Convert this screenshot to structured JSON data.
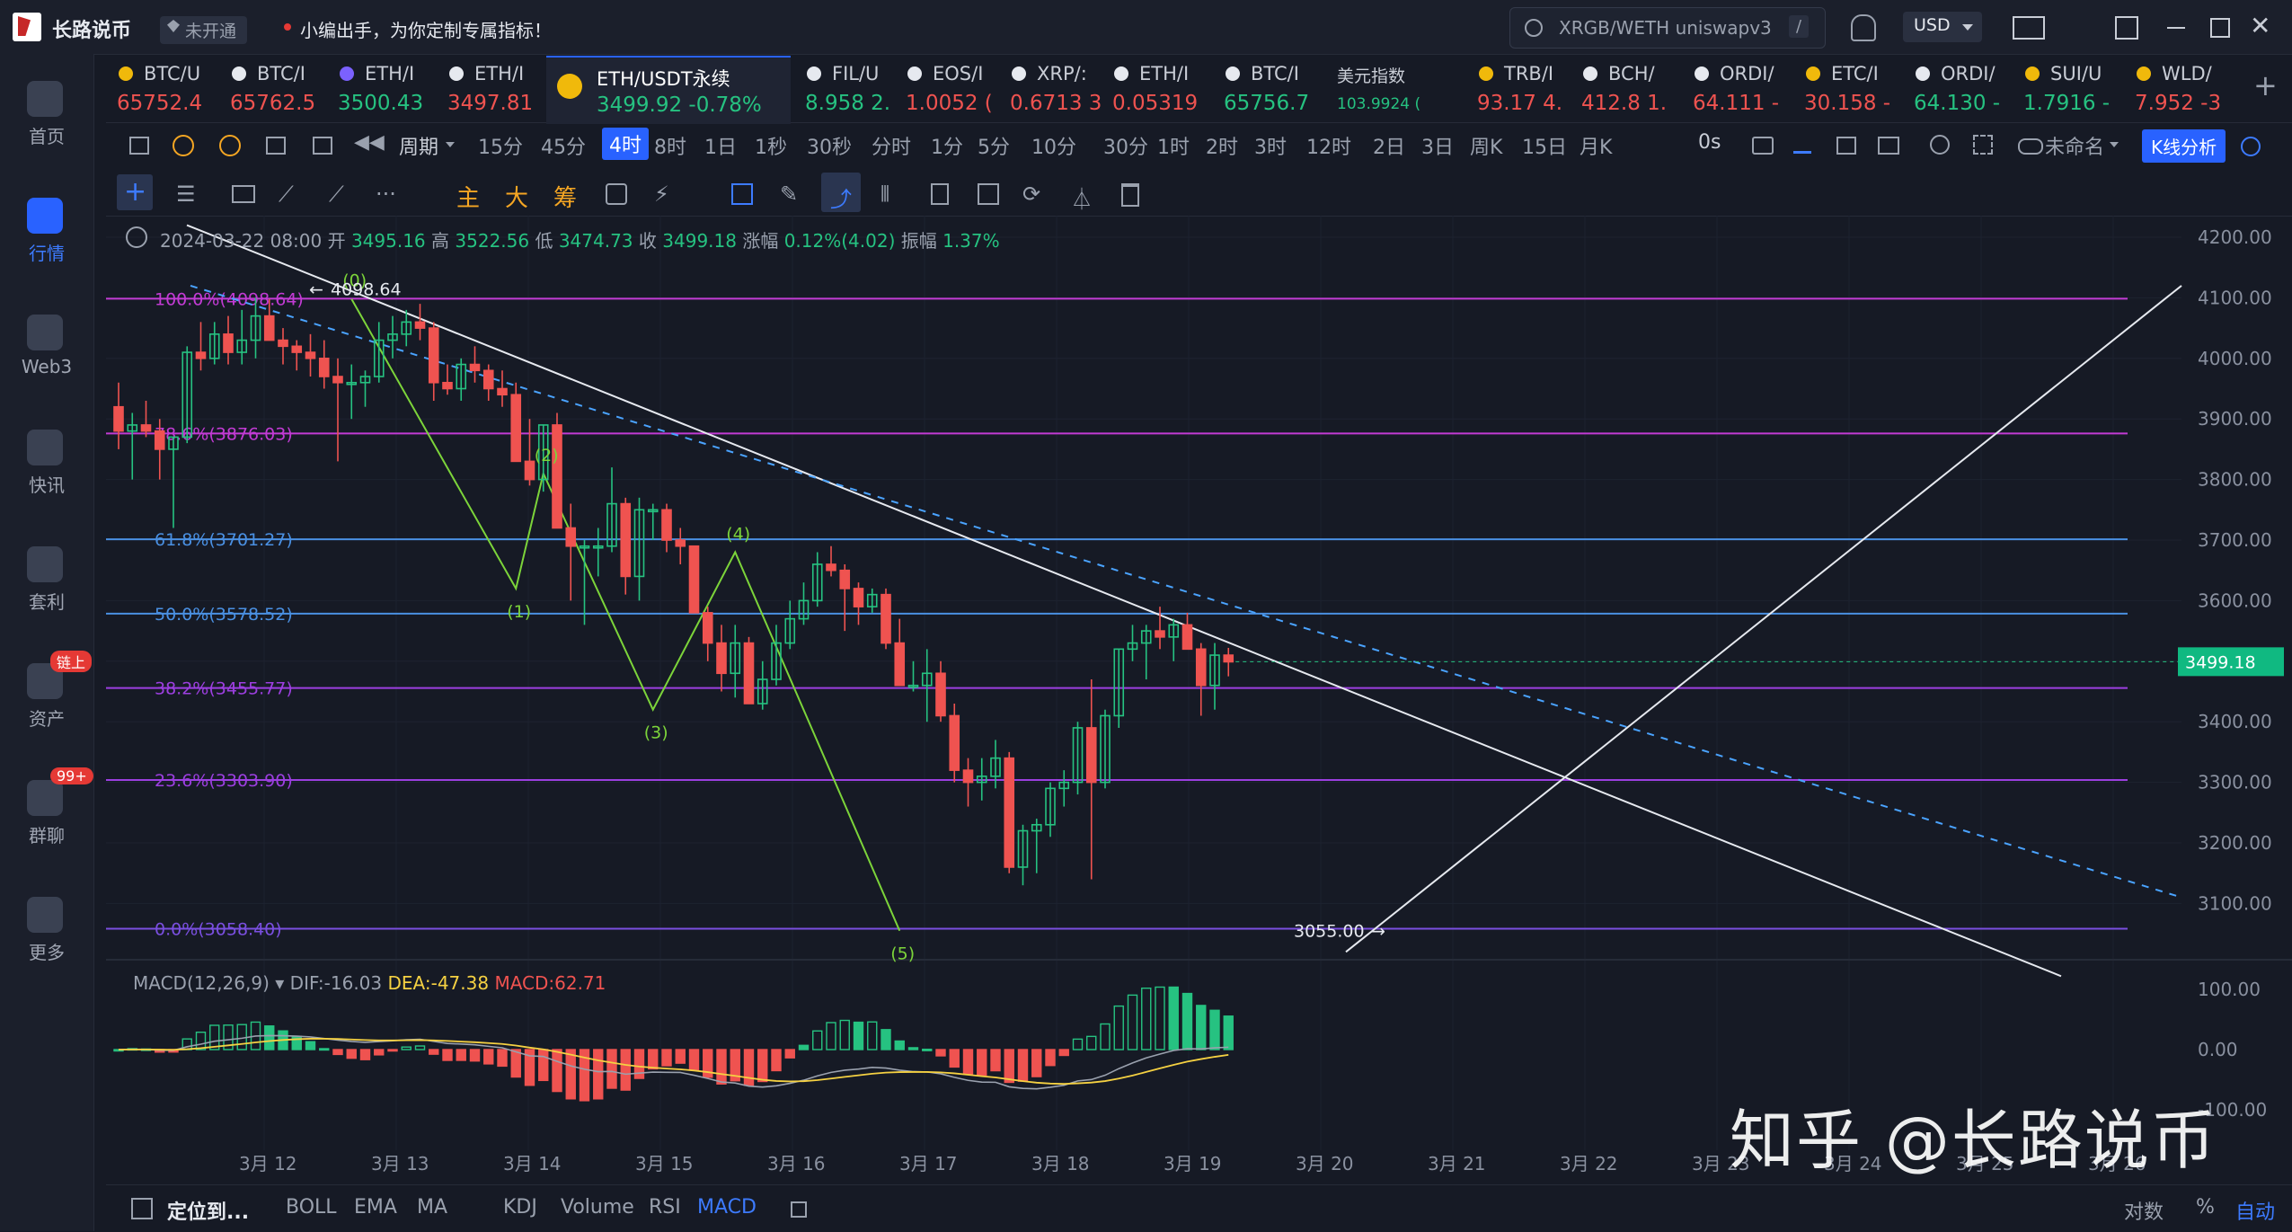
{
  "topbar": {
    "app_name": "长路说币",
    "status": "未开通",
    "notice": "小编出手，为你定制专属指标！",
    "search_placeholder": "XRGB/WETH uniswapv3",
    "search_hint": "/",
    "currency": "USD"
  },
  "tickers": [
    {
      "name": "BTC/U",
      "price": "65752.4",
      "dir": "down",
      "icon": "binance-icon"
    },
    {
      "name": "BTC/I",
      "price": "65762.5",
      "dir": "down",
      "icon": "okx-icon"
    },
    {
      "name": "ETH/I",
      "price": "3500.43",
      "dir": "up",
      "icon": "coin-icon"
    },
    {
      "name": "ETH/I",
      "price": "3497.81",
      "dir": "down",
      "icon": "okx-icon"
    },
    {
      "name": "ETH/USDT永续",
      "price": "3499.92  -0.78%",
      "dir": "up",
      "icon": "binance-icon",
      "active": true
    },
    {
      "name": "FIL/U",
      "price": "8.958  2.",
      "dir": "up",
      "icon": "okx-icon"
    },
    {
      "name": "EOS/I",
      "price": "1.0052  (",
      "dir": "down",
      "icon": "okx-icon"
    },
    {
      "name": "XRP/:",
      "price": "0.6713  3",
      "dir": "down",
      "icon": "okx-icon"
    },
    {
      "name": "ETH/I",
      "price": "0.05319",
      "dir": "down",
      "icon": "okx-icon"
    },
    {
      "name": "BTC/I",
      "price": "65756.7",
      "dir": "up",
      "icon": "okx-icon"
    },
    {
      "name": "美元指数",
      "price": "103.9924  (",
      "dir": "up",
      "icon": ""
    },
    {
      "name": "TRB/I",
      "price": "93.17  4.",
      "dir": "down",
      "icon": "binance-icon"
    },
    {
      "name": "BCH/",
      "price": "412.8  1.",
      "dir": "down",
      "icon": "okx-icon"
    },
    {
      "name": "ORDI/",
      "price": "64.111  -",
      "dir": "down",
      "icon": "okx-icon"
    },
    {
      "name": "ETC/I",
      "price": "30.158  -",
      "dir": "down",
      "icon": "binance-icon"
    },
    {
      "name": "ORDI/",
      "price": "64.130  -",
      "dir": "up",
      "icon": "okx-icon"
    },
    {
      "name": "SUI/U",
      "price": "1.7916  -",
      "dir": "up",
      "icon": "binance-icon"
    },
    {
      "name": "WLD/",
      "price": "7.952  -3",
      "dir": "down",
      "icon": "binance-icon"
    }
  ],
  "sidebar": [
    {
      "label": "首页",
      "icon": "home-icon"
    },
    {
      "label": "行情",
      "icon": "market-icon",
      "active": true
    },
    {
      "label": "Web3",
      "icon": "web3-icon"
    },
    {
      "label": "快讯",
      "icon": "news-icon"
    },
    {
      "label": "套利",
      "icon": "arbitrage-icon"
    },
    {
      "label": "资产",
      "icon": "wallet-icon",
      "badge": "链上"
    },
    {
      "label": "群聊",
      "icon": "chat-icon",
      "badge": "99+"
    },
    {
      "label": "更多",
      "icon": "more-icon"
    }
  ],
  "periods": {
    "label": "周期",
    "items": [
      "15分",
      "45分",
      "4时",
      "8时",
      "1日",
      "1秒",
      "30秒",
      "分时",
      "1分",
      "5分",
      "10分",
      "30分",
      "1时",
      "2时",
      "3时",
      "12时",
      "2日",
      "3日",
      "周K",
      "15日",
      "月K"
    ],
    "active": "4时",
    "countdown": "0s",
    "layout_name": "未命名",
    "kline_button": "K线分析"
  },
  "toolbar": {
    "indicator_buttons": [
      "主",
      "大",
      "筹"
    ]
  },
  "candle_info": {
    "time": "2024-03-22 08:00",
    "open_label": "开",
    "open": "3495.16",
    "high_label": "高",
    "high": "3522.56",
    "low_label": "低",
    "low": "3474.73",
    "close_label": "收",
    "close": "3499.18",
    "change_label": "涨幅",
    "change": "0.12%(4.02)",
    "amp_label": "振幅",
    "amp": "1.37%"
  },
  "macd_info": {
    "name": "MACD(12,26,9)",
    "dif": "DIF:-16.03",
    "dea": "DEA:-47.38",
    "macd": "MACD:62.71"
  },
  "chart_data": {
    "type": "candlestick",
    "symbol": "ETH/USDT永续",
    "interval": "4时",
    "ylim": [
      3000,
      4200
    ],
    "y_ticks": [
      "4200.00",
      "4100.00",
      "4000.00",
      "3900.00",
      "3800.00",
      "3700.00",
      "3600.00",
      "3500.00",
      "3400.00",
      "3300.00",
      "3200.00",
      "3100.00"
    ],
    "x_ticks": [
      "3月 12",
      "3月 13",
      "3月 14",
      "3月 15",
      "3月 16",
      "3月 17",
      "3月 18",
      "3月 19",
      "3月 20",
      "3月 21",
      "3月 22",
      "3月 23",
      "3月 24",
      "3月 25",
      "3月 26"
    ],
    "last_price": "3499.18",
    "fib_levels": [
      {
        "label": "100.0%(4098.64)",
        "value": 4098.64,
        "color": "#c23bd4"
      },
      {
        "label": "78.6%(3876.03)",
        "value": 3876.03,
        "color": "#c23bd4"
      },
      {
        "label": "61.8%(3701.27)",
        "value": 3701.27,
        "color": "#4a90e2"
      },
      {
        "label": "50.0%(3578.52)",
        "value": 3578.52,
        "color": "#4a90e2"
      },
      {
        "label": "38.2%(3455.77)",
        "value": 3455.77,
        "color": "#9c3fe0"
      },
      {
        "label": "23.6%(3303.90)",
        "value": 3303.9,
        "color": "#9c3fe0"
      },
      {
        "label": "0.0%(3058.40)",
        "value": 3058.4,
        "color": "#7a4fe0"
      }
    ],
    "annotations": {
      "high_marker": "4098.64",
      "low_marker": "3055.00",
      "wave_labels": [
        "(0)",
        "(1)",
        "(2)",
        "(3)",
        "(4)",
        "(5)"
      ]
    },
    "candles_ohlc": [
      [
        3920,
        3960,
        3850,
        3880
      ],
      [
        3880,
        3910,
        3800,
        3890
      ],
      [
        3890,
        3930,
        3870,
        3880
      ],
      [
        3880,
        3900,
        3800,
        3850
      ],
      [
        3850,
        3870,
        3720,
        3870
      ],
      [
        3870,
        4020,
        3860,
        4010
      ],
      [
        4010,
        4060,
        3980,
        4000
      ],
      [
        4000,
        4060,
        3990,
        4040
      ],
      [
        4040,
        4070,
        3990,
        4010
      ],
      [
        4010,
        4080,
        3990,
        4030
      ],
      [
        4030,
        4100,
        4000,
        4070
      ],
      [
        4070,
        4098,
        4030,
        4030
      ],
      [
        4030,
        4050,
        3990,
        4020
      ],
      [
        4020,
        4030,
        3980,
        4010
      ],
      [
        4010,
        4040,
        3970,
        4000
      ],
      [
        4000,
        4030,
        3950,
        3970
      ],
      [
        3970,
        4000,
        3830,
        3960
      ],
      [
        3960,
        3990,
        3900,
        3960
      ],
      [
        3960,
        3980,
        3920,
        3970
      ],
      [
        3970,
        4060,
        3960,
        4030
      ],
      [
        4030,
        4070,
        4000,
        4040
      ],
      [
        4040,
        4080,
        4020,
        4060
      ],
      [
        4060,
        4090,
        4030,
        4050
      ],
      [
        4050,
        4060,
        3930,
        3960
      ],
      [
        3960,
        3990,
        3940,
        3950
      ],
      [
        3950,
        4000,
        3930,
        3990
      ],
      [
        3990,
        4020,
        3960,
        3980
      ],
      [
        3980,
        3990,
        3930,
        3950
      ],
      [
        3950,
        3980,
        3920,
        3940
      ],
      [
        3940,
        3960,
        3830,
        3830
      ],
      [
        3830,
        3900,
        3790,
        3800
      ],
      [
        3800,
        3890,
        3780,
        3890
      ],
      [
        3890,
        3910,
        3720,
        3720
      ],
      [
        3720,
        3760,
        3600,
        3690
      ],
      [
        3690,
        3700,
        3560,
        3690
      ],
      [
        3690,
        3720,
        3640,
        3690
      ],
      [
        3690,
        3820,
        3680,
        3760
      ],
      [
        3760,
        3770,
        3610,
        3640
      ],
      [
        3640,
        3770,
        3600,
        3750
      ],
      [
        3750,
        3760,
        3700,
        3750
      ],
      [
        3750,
        3760,
        3680,
        3700
      ],
      [
        3700,
        3720,
        3660,
        3690
      ],
      [
        3690,
        3690,
        3580,
        3580
      ],
      [
        3580,
        3590,
        3500,
        3530
      ],
      [
        3530,
        3560,
        3450,
        3480
      ],
      [
        3480,
        3560,
        3440,
        3530
      ],
      [
        3530,
        3540,
        3430,
        3430
      ],
      [
        3430,
        3500,
        3420,
        3470
      ],
      [
        3470,
        3560,
        3460,
        3530
      ],
      [
        3530,
        3600,
        3520,
        3570
      ],
      [
        3570,
        3630,
        3560,
        3600
      ],
      [
        3600,
        3680,
        3590,
        3660
      ],
      [
        3660,
        3690,
        3640,
        3650
      ],
      [
        3650,
        3660,
        3550,
        3620
      ],
      [
        3620,
        3630,
        3560,
        3590
      ],
      [
        3590,
        3620,
        3580,
        3610
      ],
      [
        3610,
        3620,
        3520,
        3530
      ],
      [
        3530,
        3570,
        3480,
        3460
      ],
      [
        3460,
        3500,
        3450,
        3460
      ],
      [
        3460,
        3520,
        3400,
        3480
      ],
      [
        3480,
        3500,
        3400,
        3410
      ],
      [
        3410,
        3430,
        3300,
        3320
      ],
      [
        3320,
        3340,
        3260,
        3300
      ],
      [
        3300,
        3340,
        3270,
        3310
      ],
      [
        3310,
        3370,
        3290,
        3340
      ],
      [
        3340,
        3350,
        3150,
        3160
      ],
      [
        3160,
        3230,
        3130,
        3220
      ],
      [
        3220,
        3240,
        3150,
        3230
      ],
      [
        3230,
        3300,
        3210,
        3290
      ],
      [
        3290,
        3320,
        3260,
        3300
      ],
      [
        3300,
        3400,
        3280,
        3390
      ],
      [
        3390,
        3470,
        3140,
        3300
      ],
      [
        3300,
        3420,
        3290,
        3410
      ],
      [
        3410,
        3520,
        3390,
        3520
      ],
      [
        3520,
        3560,
        3500,
        3530
      ],
      [
        3530,
        3560,
        3470,
        3550
      ],
      [
        3550,
        3590,
        3520,
        3540
      ],
      [
        3540,
        3570,
        3500,
        3560
      ],
      [
        3560,
        3580,
        3520,
        3520
      ],
      [
        3520,
        3530,
        3410,
        3460
      ],
      [
        3460,
        3530,
        3420,
        3510
      ],
      [
        3510,
        3522,
        3475,
        3499
      ]
    ]
  },
  "macd_chart": {
    "y_ticks": [
      "100.00",
      "0.00",
      "-100.00"
    ]
  },
  "bottombar": {
    "locate": "定位到...",
    "indicators": [
      "BOLL",
      "EMA",
      "MA",
      "KDJ",
      "Volume",
      "RSI",
      "MACD"
    ],
    "active_indicator": "MACD",
    "right_items": [
      "对数",
      "%",
      "自动"
    ],
    "auto_active": "自动"
  },
  "watermark": "知乎 @长路说币"
}
